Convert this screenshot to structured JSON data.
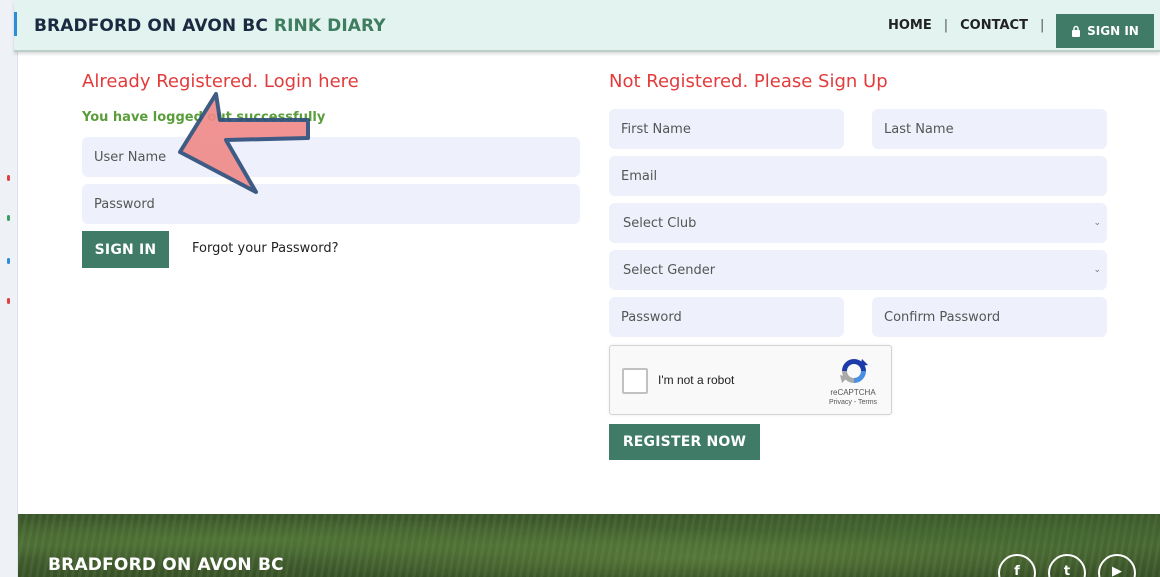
{
  "header": {
    "brand_primary": "BRADFORD ON AVON BC",
    "brand_accent": "RINK DIARY",
    "nav": {
      "home": "HOME",
      "contact": "CONTACT",
      "separator": "|",
      "signin": "SIGN IN"
    }
  },
  "login": {
    "heading": "Already Registered. Login here",
    "success_message": "You have logged out successfully",
    "username_placeholder": "User Name",
    "password_placeholder": "Password",
    "signin_button": "SIGN IN",
    "forgot_link": "Forgot your Password?"
  },
  "register": {
    "heading": "Not Registered. Please Sign Up",
    "first_name_placeholder": "First Name",
    "last_name_placeholder": "Last Name",
    "email_placeholder": "Email",
    "club_select": "Select Club",
    "gender_select": "Select Gender",
    "password_placeholder": "Password",
    "confirm_password_placeholder": "Confirm Password",
    "captcha": {
      "label": "I'm not a robot",
      "brand": "reCAPTCHA",
      "links": "Privacy - Terms"
    },
    "register_button": "REGISTER NOW"
  },
  "footer": {
    "brand": "BRADFORD ON AVON BC",
    "social": {
      "facebook": "f",
      "twitter": "t",
      "youtube": "▶"
    }
  },
  "colors": {
    "accent_green": "#3f7b67",
    "heading_red": "#e23b3b",
    "success_green": "#5a9d3a",
    "field_bg": "#eef1fb",
    "header_bg": "#e3f3ef"
  }
}
